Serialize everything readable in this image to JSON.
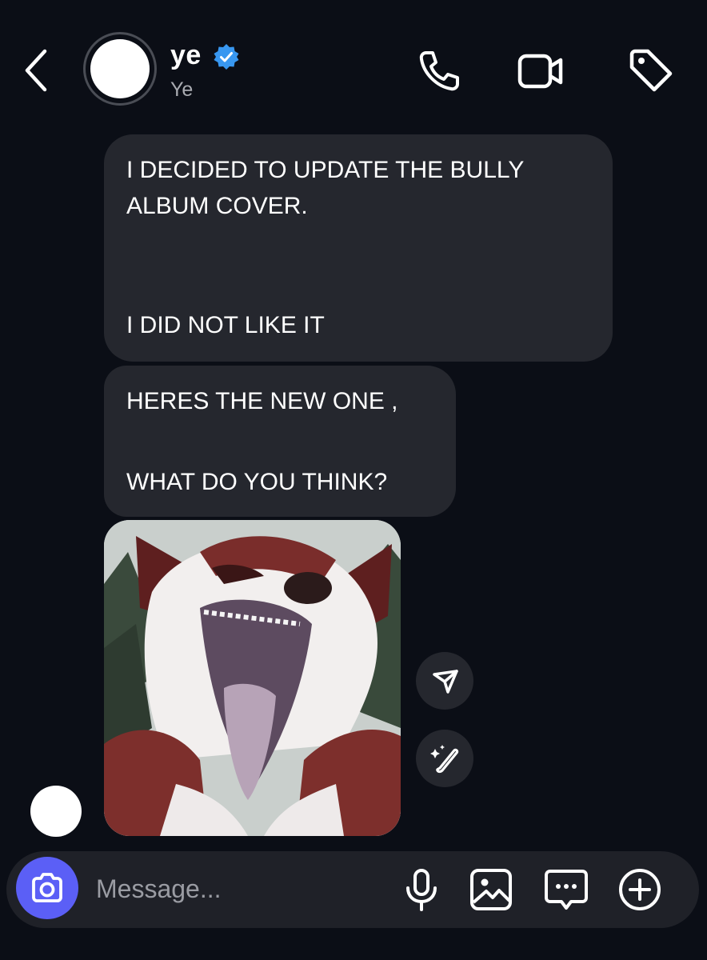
{
  "header": {
    "contact_name": "ye",
    "contact_subtitle": "Ye",
    "verified": true,
    "icons": [
      "back-chevron-icon",
      "phone-icon",
      "video-camera-icon",
      "tag-icon"
    ]
  },
  "messages": [
    {
      "type": "text",
      "lines": [
        "I DECIDED TO UPDATE THE BULLY",
        "ALBUM COVER."
      ],
      "lines_after_gap": [
        "I DID NOT LIKE IT"
      ]
    },
    {
      "type": "text",
      "lines": [
        "HERES THE NEW ONE ,"
      ],
      "lines_after_gap": [
        "WHAT DO YOU THINK?"
      ]
    },
    {
      "type": "image",
      "actions": [
        "share-icon",
        "ai-edit-icon"
      ]
    }
  ],
  "composer": {
    "placeholder": "Message...",
    "value": "",
    "icons": [
      "camera-icon",
      "microphone-icon",
      "gallery-icon",
      "sticker-icon",
      "plus-icon"
    ]
  },
  "colors": {
    "background": "#0b0e16",
    "bubble": "#25272e",
    "verified": "#3897f0",
    "camera_button": "#5b5ff6"
  }
}
